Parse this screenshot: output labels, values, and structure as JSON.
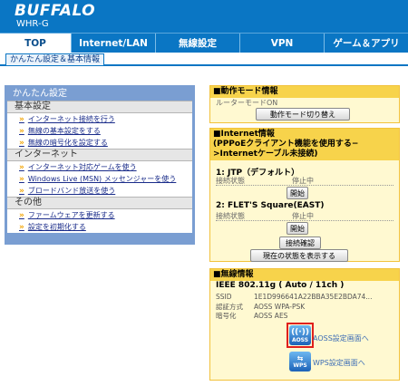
{
  "header": {
    "brand": "BUFFALO",
    "model": "WHR-G"
  },
  "nav": {
    "tabs": [
      {
        "label": "TOP",
        "active": true
      },
      {
        "label": "Internet/LAN",
        "active": false
      },
      {
        "label": "無線設定",
        "active": false
      },
      {
        "label": "VPN",
        "active": false
      },
      {
        "label": "ゲーム＆アプリ",
        "active": false
      }
    ],
    "subtab": "かんたん設定＆基本情報"
  },
  "menu": {
    "title": "かんたん設定",
    "sections": [
      {
        "label": "基本設定",
        "items": [
          "インターネット接続を行う",
          "無線の基本設定をする",
          "無線の暗号化を設定する"
        ]
      },
      {
        "label": "インターネット",
        "items": [
          "インターネット対応ゲームを使う",
          "Windows Live (MSN) メッセンジャーを使う",
          "ブロードバンド放送を使う"
        ]
      },
      {
        "label": "その他",
        "items": [
          "ファームウェアを更新する",
          "設定を初期化する"
        ]
      }
    ]
  },
  "mode_panel": {
    "title": "■動作モード情報",
    "value": "ルーターモードON",
    "button": "動作モード切り替え"
  },
  "internet_panel": {
    "title": "■Internet情報",
    "subtitle_1": "(PPPoEクライアント機能を使用する−",
    "subtitle_2": ">Internetケーブル未接続)",
    "connections": [
      {
        "name": "1: JTP（デフォルト）",
        "status_label": "接続状態",
        "status_value": "停止中",
        "button": "開始"
      },
      {
        "name": "2: FLET'S Square(EAST)",
        "status_label": "接続状態",
        "status_value": "停止中",
        "button": "開始"
      }
    ],
    "check_button": "接続確認",
    "show_status_button": "現在の状態を表示する"
  },
  "wireless_panel": {
    "title": "■無線情報",
    "standard": "IEEE 802.11g ( Auto / 11ch )",
    "rows": [
      {
        "key": "SSID",
        "value": "1E1D996641A22BBA35E2BDA74..."
      },
      {
        "key": "認証方式",
        "value": "AOSS WPA-PSK"
      },
      {
        "key": "暗号化",
        "value": "AOSS AES"
      }
    ],
    "aoss_link": "AOSS設定画面へ",
    "aoss_icon_text": "AOSS",
    "wps_link": "WPS設定画面へ",
    "wps_icon_text": "WPS",
    "highlight_color": "#e0201c"
  },
  "colors": {
    "brand_blue": "#0a76c4",
    "menu_blue": "#7a9ed2",
    "panel_yellow": "#f7d34b"
  }
}
